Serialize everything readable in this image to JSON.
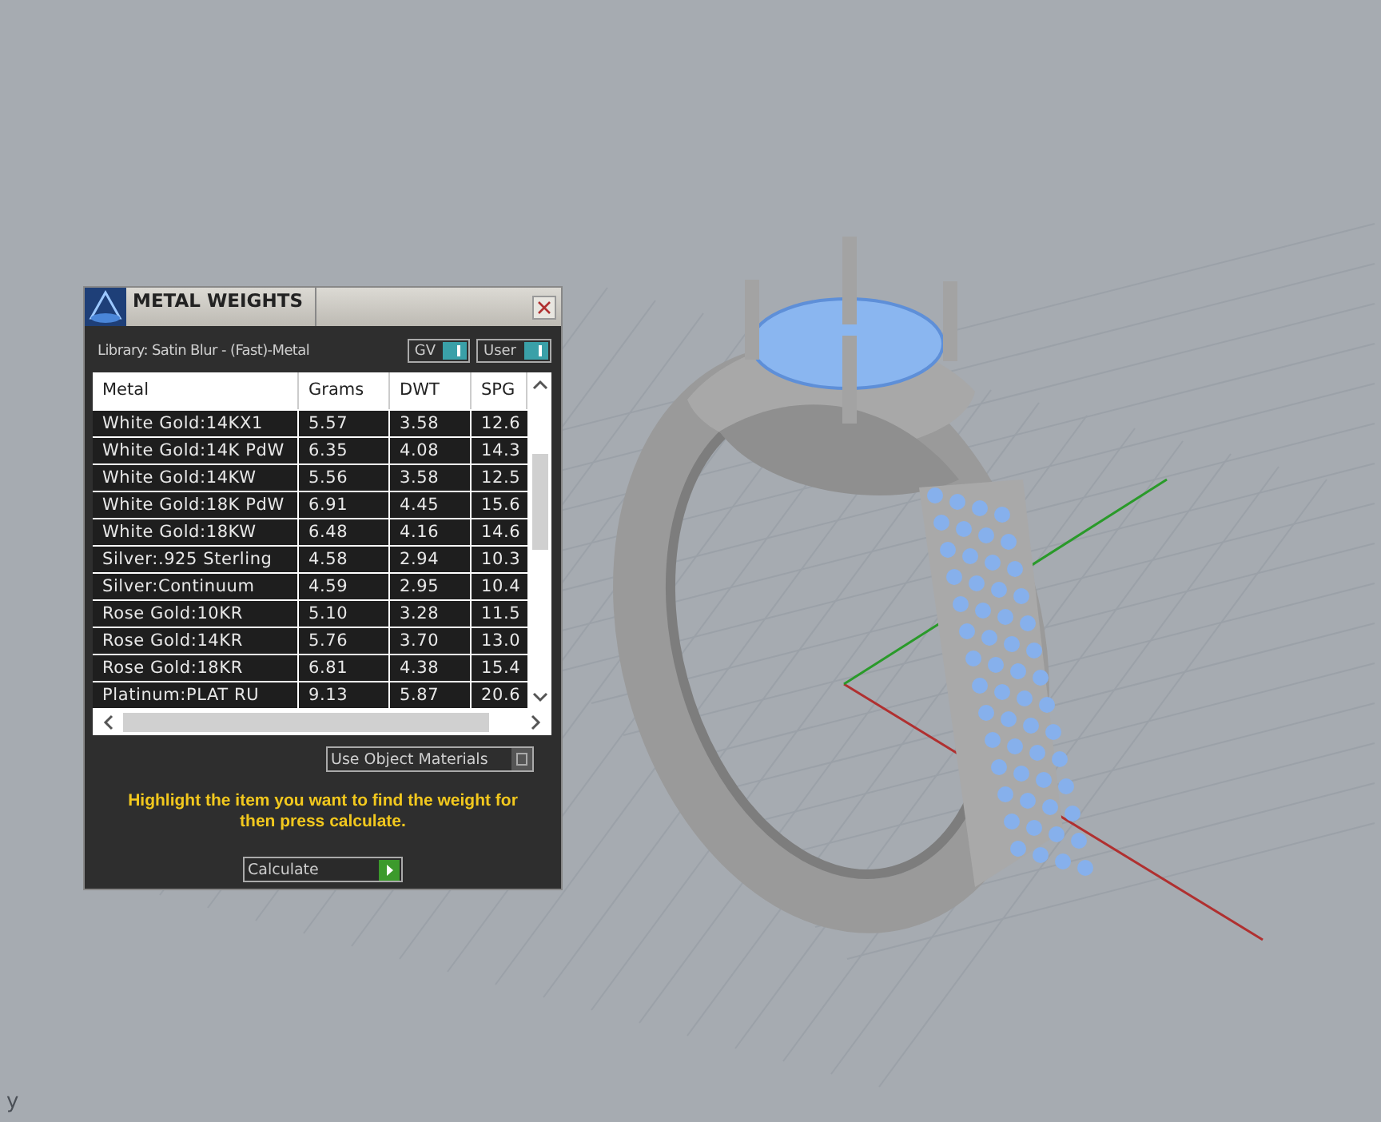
{
  "viewport": {
    "axis_label": "y"
  },
  "panel": {
    "title": "METAL WEIGHTS",
    "library": "Library: Satin Blur - (Fast)-Metal",
    "toggles": [
      {
        "label": "GV",
        "on": true
      },
      {
        "label": "User",
        "on": true
      }
    ],
    "table": {
      "columns": [
        "Metal",
        "Grams",
        "DWT",
        "SPG"
      ],
      "rows": [
        [
          "White Gold:14KX1",
          "5.57",
          "3.58",
          "12.6"
        ],
        [
          "White Gold:14K PdW",
          "6.35",
          "4.08",
          "14.3"
        ],
        [
          "White Gold:14KW",
          "5.56",
          "3.58",
          "12.5"
        ],
        [
          "White Gold:18K PdW",
          "6.91",
          "4.45",
          "15.6"
        ],
        [
          "White Gold:18KW",
          "6.48",
          "4.16",
          "14.6"
        ],
        [
          "Silver:.925 Sterling",
          "4.58",
          "2.94",
          "10.3"
        ],
        [
          "Silver:Continuum",
          "4.59",
          "2.95",
          "10.4"
        ],
        [
          "Rose Gold:10KR",
          "5.10",
          "3.28",
          "11.5"
        ],
        [
          "Rose Gold:14KR",
          "5.76",
          "3.70",
          "13.0"
        ],
        [
          "Rose Gold:18KR",
          "6.81",
          "4.38",
          "15.4"
        ],
        [
          "Platinum:PLAT RU",
          "9.13",
          "5.87",
          "20.6"
        ]
      ]
    },
    "use_object_materials": {
      "label": "Use Object Materials",
      "on": false
    },
    "hint": "Highlight the item you want to find the weight for then press calculate.",
    "calculate_button": "Calculate"
  }
}
